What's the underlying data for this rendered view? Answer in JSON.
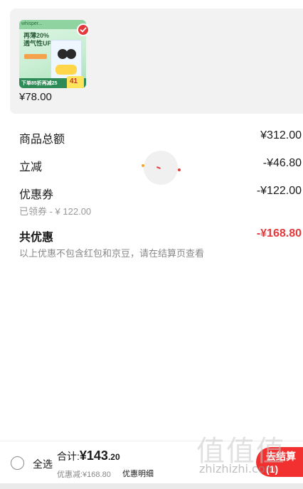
{
  "product": {
    "thumb_top_text": "whisper...",
    "thumb_headline": "再薄20%\n透气性UP",
    "thumb_bottom_text": "下单85折再减25",
    "thumb_badge_price": "41",
    "price": "¥78.00"
  },
  "summary": {
    "goods_total_label": "商品总额",
    "goods_total_value": "¥312.00",
    "instant_discount_label": "立减",
    "instant_discount_value": "-¥46.80",
    "coupon_label": "优惠券",
    "coupon_value": "-¥122.00",
    "coupon_sub": "已领券 - ¥ 122.00",
    "total_discount_label": "共优惠",
    "total_discount_value": "-¥168.80",
    "note": "以上优惠不包含红包和京豆，请在结算页查看"
  },
  "bottom_bar": {
    "select_all": "全选",
    "total_prefix": "合计:",
    "total_currency": "¥",
    "total_integer": "143",
    "total_decimal": ".20",
    "discount_line": "优惠减:¥168.80",
    "detail_link": "优惠明细",
    "checkout_label": "去结算(1)"
  },
  "watermark": {
    "text": "值值值",
    "url": "zhizhizhi.com"
  },
  "colors": {
    "accent": "#e4393c",
    "checkout": "#f23030",
    "card_bg": "#f2f2f2"
  }
}
